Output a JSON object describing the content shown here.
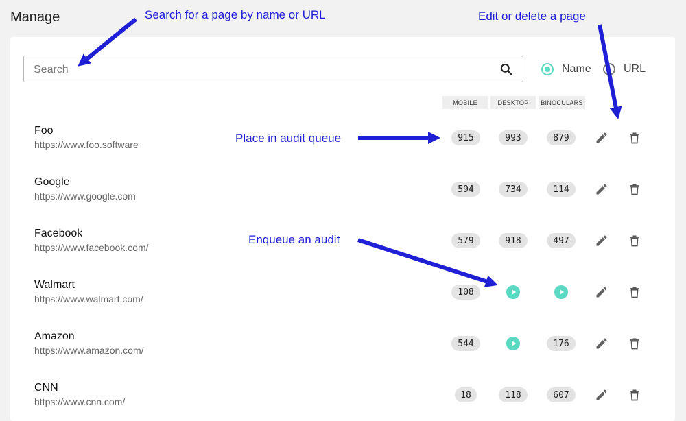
{
  "header": {
    "title": "Manage"
  },
  "search": {
    "placeholder": "Search",
    "value": ""
  },
  "filter": {
    "options": [
      {
        "label": "Name",
        "selected": true
      },
      {
        "label": "URL",
        "selected": false
      }
    ]
  },
  "columns": [
    "MOBILE",
    "DESKTOP",
    "BINOCULARS"
  ],
  "rows": [
    {
      "name": "Foo",
      "url": "https://www.foo.software",
      "scores": [
        "915",
        "993",
        "879"
      ]
    },
    {
      "name": "Google",
      "url": "https://www.google.com",
      "scores": [
        "594",
        "734",
        "114"
      ]
    },
    {
      "name": "Facebook",
      "url": "https://www.facebook.com/",
      "scores": [
        "579",
        "918",
        "497"
      ]
    },
    {
      "name": "Walmart",
      "url": "https://www.walmart.com/",
      "scores": [
        "108",
        null,
        null
      ]
    },
    {
      "name": "Amazon",
      "url": "https://www.amazon.com/",
      "scores": [
        "544",
        null,
        "176"
      ]
    },
    {
      "name": "CNN",
      "url": "https://www.cnn.com/",
      "scores": [
        "18",
        "118",
        "607"
      ]
    }
  ],
  "annotations": {
    "search": "Search for a page by name or URL",
    "edit_delete": "Edit or delete a page",
    "queue": "Place in audit queue",
    "enqueue": "Enqueue an audit"
  },
  "colors": {
    "accent": "#5ad9c3",
    "annotation": "#1f1fd6"
  },
  "icons": {
    "search": "search-icon",
    "edit": "pencil-icon",
    "delete": "trash-icon",
    "play": "play-icon"
  }
}
